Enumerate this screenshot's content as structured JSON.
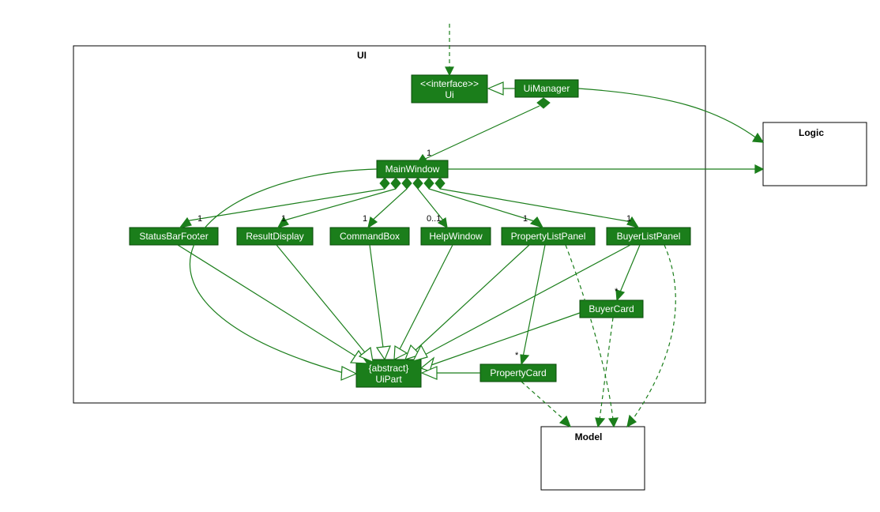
{
  "package": {
    "title": "UI"
  },
  "external": {
    "logic": "Logic",
    "model": "Model"
  },
  "nodes": {
    "ui_interface": {
      "stereo": "<<interface>>",
      "name": "Ui"
    },
    "uimanager": {
      "name": "UiManager"
    },
    "mainwindow": {
      "name": "MainWindow"
    },
    "statusbar": {
      "name": "StatusBarFooter"
    },
    "resultdisp": {
      "name": "ResultDisplay"
    },
    "commandbox": {
      "name": "CommandBox"
    },
    "helpwindow": {
      "name": "HelpWindow"
    },
    "proplist": {
      "name": "PropertyListPanel"
    },
    "buyerlist": {
      "name": "BuyerListPanel"
    },
    "buyercard": {
      "name": "BuyerCard"
    },
    "propcard": {
      "name": "PropertyCard"
    },
    "uipart": {
      "stereo": "{abstract}",
      "name": "UiPart"
    }
  },
  "mult": {
    "mainwindow": "1",
    "statusbar": "1",
    "resultdisp": "1",
    "commandbox": "1",
    "helpwindow": "0..1",
    "proplist": "1",
    "buyerlist": "1",
    "buyercard": "*",
    "propcard": "*"
  }
}
